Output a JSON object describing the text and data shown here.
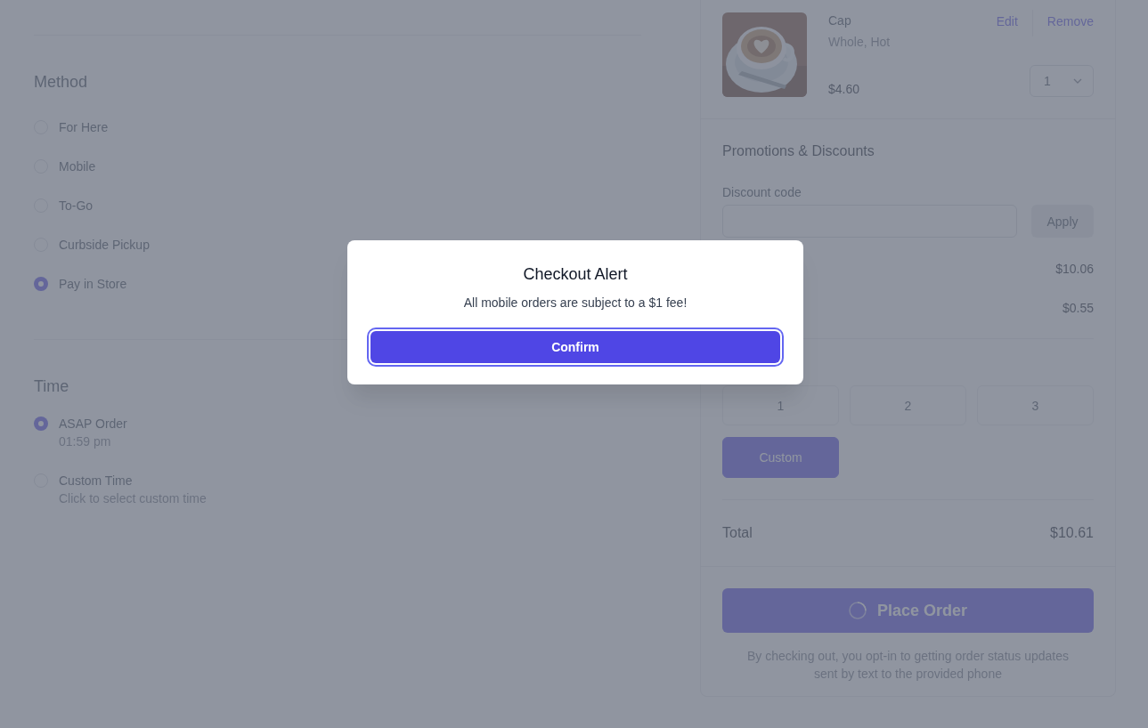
{
  "method": {
    "title": "Method",
    "options": [
      {
        "label": "For Here",
        "selected": false
      },
      {
        "label": "Mobile",
        "selected": false
      },
      {
        "label": "To-Go",
        "selected": false
      },
      {
        "label": "Curbside Pickup",
        "selected": false
      },
      {
        "label": "Pay in Store",
        "selected": true
      }
    ]
  },
  "time": {
    "title": "Time",
    "options": [
      {
        "label": "ASAP Order",
        "sublabel": "01:59 pm",
        "selected": true
      },
      {
        "label": "Custom Time",
        "sublabel": "Click to select custom time",
        "selected": false
      }
    ]
  },
  "cart": {
    "items": [
      {
        "name": "Cap",
        "options": "Whole, Hot",
        "price": "$4.60",
        "quantity": "1",
        "actions": [
          "Edit",
          "Remove"
        ]
      }
    ]
  },
  "promotions": {
    "title": "Promotions & Discounts",
    "field_label": "Discount code",
    "apply": "Apply"
  },
  "summary": [
    {
      "value": "$10.06"
    },
    {
      "value": "$0.55"
    }
  ],
  "tip": {
    "options": [
      {
        "label": "1",
        "selected": false
      },
      {
        "label": "2",
        "selected": false
      },
      {
        "label": "3",
        "selected": false
      },
      {
        "label": "Custom",
        "selected": true
      }
    ]
  },
  "total": {
    "label": "Total",
    "value": "$10.61"
  },
  "place_order": {
    "label": "Place Order",
    "loading": true
  },
  "disclaimer": "By checking out, you opt-in to getting order status updates sent by text to the provided phone",
  "modal": {
    "title": "Checkout Alert",
    "message": "All mobile orders are subject to a $1 fee!",
    "confirm": "Confirm"
  }
}
